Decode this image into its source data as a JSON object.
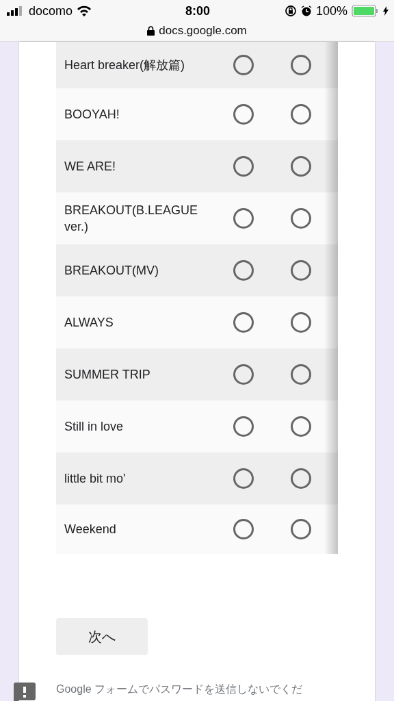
{
  "status_bar": {
    "carrier": "docomo",
    "time": "8:00",
    "battery": "100%",
    "url": "docs.google.com"
  },
  "grid": {
    "rows": [
      {
        "label": "Heart breaker(解放篇)",
        "options": [
          {
            "selected": false
          },
          {
            "selected": false
          }
        ]
      },
      {
        "label": "BOOYAH!",
        "options": [
          {
            "selected": false
          },
          {
            "selected": false
          }
        ]
      },
      {
        "label": "WE ARE!",
        "options": [
          {
            "selected": false
          },
          {
            "selected": false
          }
        ]
      },
      {
        "label": "BREAKOUT(B.LEAGUE ver.)",
        "options": [
          {
            "selected": false
          },
          {
            "selected": false
          }
        ]
      },
      {
        "label": "BREAKOUT(MV)",
        "options": [
          {
            "selected": false
          },
          {
            "selected": false
          }
        ]
      },
      {
        "label": "ALWAYS",
        "options": [
          {
            "selected": false
          },
          {
            "selected": false
          }
        ]
      },
      {
        "label": "SUMMER TRIP",
        "options": [
          {
            "selected": false
          },
          {
            "selected": false
          }
        ]
      },
      {
        "label": "Still in love",
        "options": [
          {
            "selected": false
          },
          {
            "selected": false
          }
        ]
      },
      {
        "label": "little bit mo'",
        "options": [
          {
            "selected": false
          },
          {
            "selected": false
          }
        ]
      },
      {
        "label": "Weekend",
        "options": [
          {
            "selected": false
          },
          {
            "selected": false
          }
        ]
      }
    ]
  },
  "next_button": "次へ",
  "footer_note": "Google フォームでパスワードを送信しないでくだ"
}
